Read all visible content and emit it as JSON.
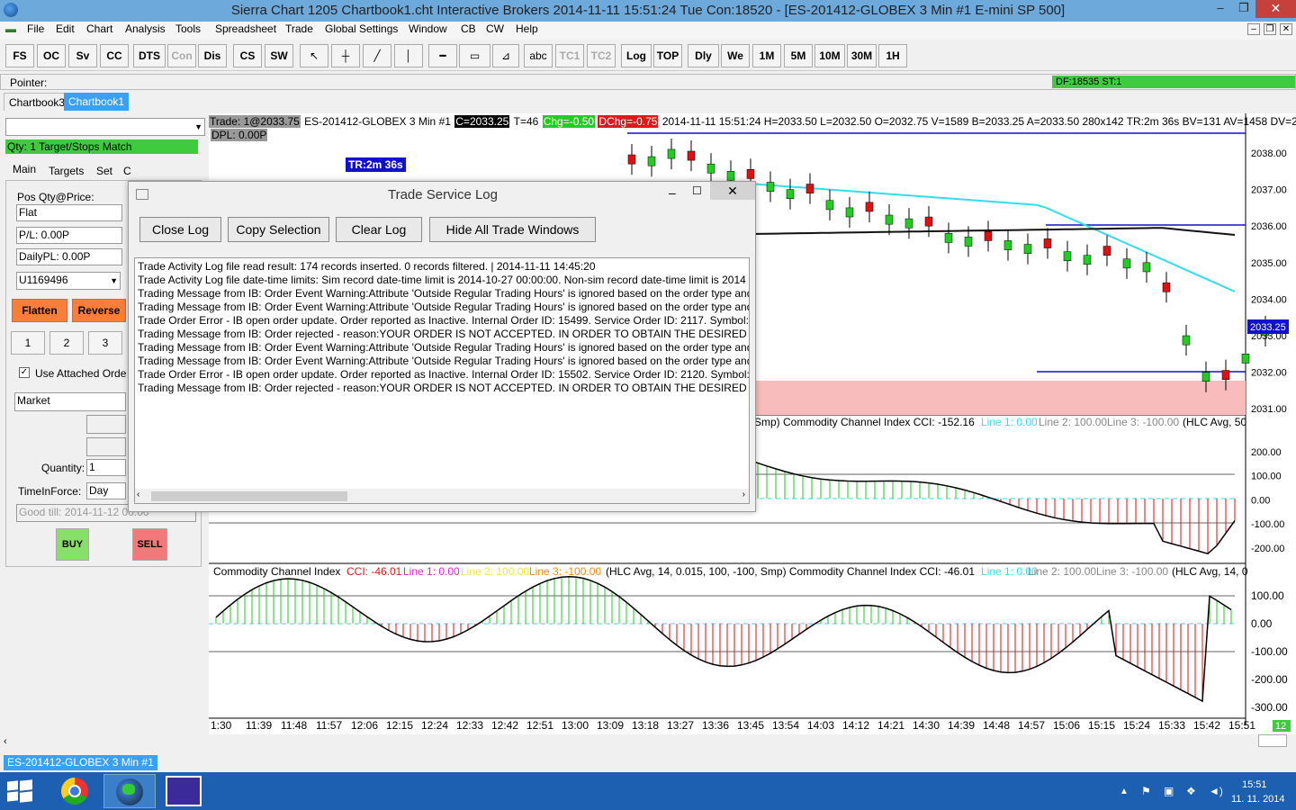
{
  "window": {
    "title": "Sierra Chart 1205 Chartbook1.cht  Interactive Brokers 2014-11-11   15:51:24 Tue   Con:18520 - [ES-201412-GLOBEX  3 Min   #1  E-mini SP 500]"
  },
  "menu": [
    "File",
    "Edit",
    "Chart",
    "Analysis",
    "Tools",
    "Spreadsheet",
    "Trade",
    "Global Settings",
    "Window",
    "CB",
    "CW",
    "Help"
  ],
  "toolbar": [
    "FS",
    "OC",
    "Sv",
    "CC",
    "DTS",
    "Con",
    "Dis",
    "CS",
    "SW",
    "abc",
    "TC1",
    "TC2",
    "Log",
    "TOP",
    "Dly",
    "We",
    "1M",
    "5M",
    "10M",
    "30M",
    "1H"
  ],
  "pointer": {
    "label": "Pointer:",
    "df": "DF:18535  ST:1"
  },
  "chartbook_tabs": [
    "Chartbook3",
    "Chartbook1"
  ],
  "trade_panel": {
    "qty_status": "Qty: 1 Target/Stops Match",
    "tabs": [
      "Main",
      "Targets",
      "Set",
      "C"
    ],
    "pos_label": "Pos Qty@Price:",
    "pos_value": "Flat",
    "pl": "P/L: 0.00P",
    "daily_pl": "DailyPL: 0.00P",
    "account": "U1169496",
    "flatten": "Flatten",
    "reverse": "Reverse",
    "qty_buttons": [
      "1",
      "2",
      "3"
    ],
    "use_attached": "Use Attached Orde",
    "order_type": "Market",
    "quantity_label": "Quantity:",
    "quantity": "1",
    "tif_label": "TimeInForce:",
    "tif": "Day",
    "good_till": "Good till: 2014-11-12 00:00",
    "buy": "BUY",
    "sell": "SELL"
  },
  "chart_header": {
    "trade": "Trade: 1@2033.75",
    "symbol": "ES-201412-GLOBEX  3 Min   #1",
    "close": "C=2033.25",
    "t": "T=46",
    "chg": "Chg=-0.50",
    "dchg": "DChg=-0.75",
    "rest": "2014-11-11  15:51:24 H=2033.50  L=2032.50  O=2032.75  V=1589  B=2033.25  A=2033.50  280x142  TR:2m 36s  BV=131  AV=1458  DV=2240",
    "dpl": "DPL: 0.00P",
    "tr": "TR:2m 36s"
  },
  "price_axis": [
    "2038.00",
    "2037.00",
    "2036.00",
    "2035.00",
    "2034.00",
    "2033.00",
    "2032.00",
    "2031.00"
  ],
  "last_price": "2033.25",
  "cci1": {
    "label": "Smp)  Commodity Channel Index  CCI: -152.16",
    "l1": "Line 1: 0.00",
    "l2": "Line 2: 100.00",
    "l3": "Line 3: -100.00",
    "tail": "(HLC Avg, 50",
    "axis": [
      "200.00",
      "100.00",
      "0.00",
      "-100.00",
      "-200.00"
    ]
  },
  "cci2": {
    "label_a": "Commodity Channel Index",
    "cci_a": "CCI: -46.01",
    "l1_a": "Line 1: 0.00",
    "l2_a": "Line 2: 100.00",
    "l3_a": "Line 3: -100.00",
    "mid": "(HLC Avg, 14, 0.015, 100, -100, Smp)  Commodity Channel Index  CCI: -46.01",
    "l1_b": "Line 1: 0.00",
    "l2_b": "Line 2: 100.00",
    "l3_b": "Line 3: -100.00",
    "tail": "(HLC Avg, 14, 0",
    "axis": [
      "100.00",
      "0.00",
      "-100.00",
      "-200.00",
      "-300.00"
    ]
  },
  "time_axis": [
    "1:30",
    "11:39",
    "11:48",
    "11:57",
    "12:06",
    "12:15",
    "12:24",
    "12:33",
    "12:42",
    "12:51",
    "13:00",
    "13:09",
    "13:18",
    "13:27",
    "13:36",
    "13:45",
    "13:54",
    "14:03",
    "14:12",
    "14:21",
    "14:30",
    "14:39",
    "14:48",
    "14:57",
    "15:06",
    "15:15",
    "15:24",
    "15:33",
    "15:42",
    "15:51"
  ],
  "bar_count": "12",
  "dialog": {
    "title": "Trade Service Log",
    "buttons": [
      "Close Log",
      "Copy Selection",
      "Clear Log",
      "Hide All Trade Windows"
    ],
    "lines": [
      "Trade Activity Log file read result: 174 records inserted.  0 records filtered. | 2014-11-11  14:45:20",
      "Trade Activity Log file date-time limits: Sim record date-time limit is 2014-10-27  00:00:00.  Non-sim record date-time limit is 2014",
      "Trading Message from IB: Order Event Warning:Attribute 'Outside Regular Trading Hours' is ignored based on the order type and",
      "Trading Message from IB: Order Event Warning:Attribute 'Outside Regular Trading Hours' is ignored based on the order type and",
      "Trade Order Error - IB open order update. Order reported as Inactive.  Internal Order ID: 15499.  Service Order ID: 2117. Symbol: ES-",
      "Trading Message from IB: Order rejected - reason:YOUR ORDER IS NOT ACCEPTED. IN ORDER TO OBTAIN THE DESIRED POSITIO",
      "Trading Message from IB: Order Event Warning:Attribute 'Outside Regular Trading Hours' is ignored based on the order type and",
      "Trading Message from IB: Order Event Warning:Attribute 'Outside Regular Trading Hours' is ignored based on the order type and",
      "Trade Order Error - IB open order update. Order reported as Inactive.  Internal Order ID: 15502.  Service Order ID: 2120. Symbol: ES-",
      "Trading Message from IB: Order rejected - reason:YOUR ORDER IS NOT ACCEPTED. IN ORDER TO OBTAIN THE DESIRED POSITIO"
    ]
  },
  "status_tab": "ES-201412-GLOBEX  3 Min   #1",
  "clock": {
    "time": "15:51",
    "date": "11. 11. 2014"
  },
  "colors": {
    "up": "#22cc22",
    "down": "#dd1111",
    "cyan": "#33ddee",
    "blue": "#1111cc"
  }
}
